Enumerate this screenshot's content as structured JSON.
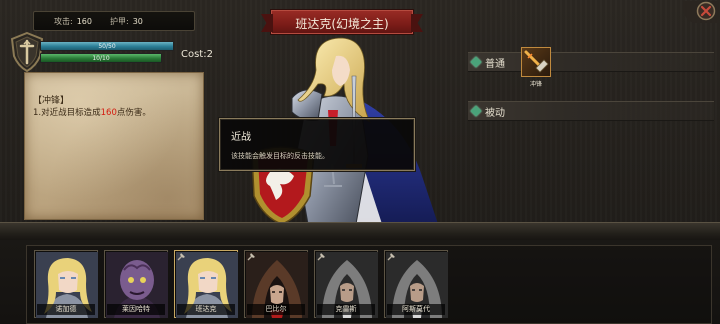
{
  "stats": {
    "attack_label": "攻击:",
    "attack_value": "160",
    "armor_label": "护甲:",
    "armor_value": "30"
  },
  "bars": {
    "hp_text": "50/50",
    "hp_fraction": 1.0,
    "mp_text": "10/10",
    "mp_fraction": 1.0
  },
  "cost": "Cost:2",
  "skill": {
    "title": "【冲锋】",
    "desc_prefix": "1.对近战目标造成",
    "damage": "160",
    "desc_suffix": "点伤害。"
  },
  "banner_title": "班达克(幻境之主)",
  "skill_rows": {
    "normal_label": "普通",
    "passive_label": "被动",
    "slot_label": "冲锋"
  },
  "tooltip": {
    "title": "近战",
    "desc": "该技能会触发目标的反击技能。"
  },
  "roster": [
    {
      "name": "诺加德",
      "portrait": "blonde-knight-portrait",
      "hammer": false,
      "selected": false
    },
    {
      "name": "莱因哈特",
      "portrait": "purple-demon-portrait",
      "hammer": false,
      "selected": false
    },
    {
      "name": "班达克",
      "portrait": "blonde-knight-portrait",
      "hammer": true,
      "selected": true
    },
    {
      "name": "巴比尔",
      "portrait": "hooded-monk-portrait",
      "hammer": true,
      "selected": false
    },
    {
      "name": "克雷斯",
      "portrait": "grey-hood-portrait",
      "hammer": true,
      "selected": false
    },
    {
      "name": "阿斯莫代",
      "portrait": "grey-hood-portrait",
      "hammer": true,
      "selected": false
    }
  ],
  "colors": {
    "banner": "#8b2620",
    "damage_text": "#d41c10",
    "hp_bar": "#2b7e96",
    "mp_bar": "#2a7c38",
    "gem": "#4aa37a"
  }
}
